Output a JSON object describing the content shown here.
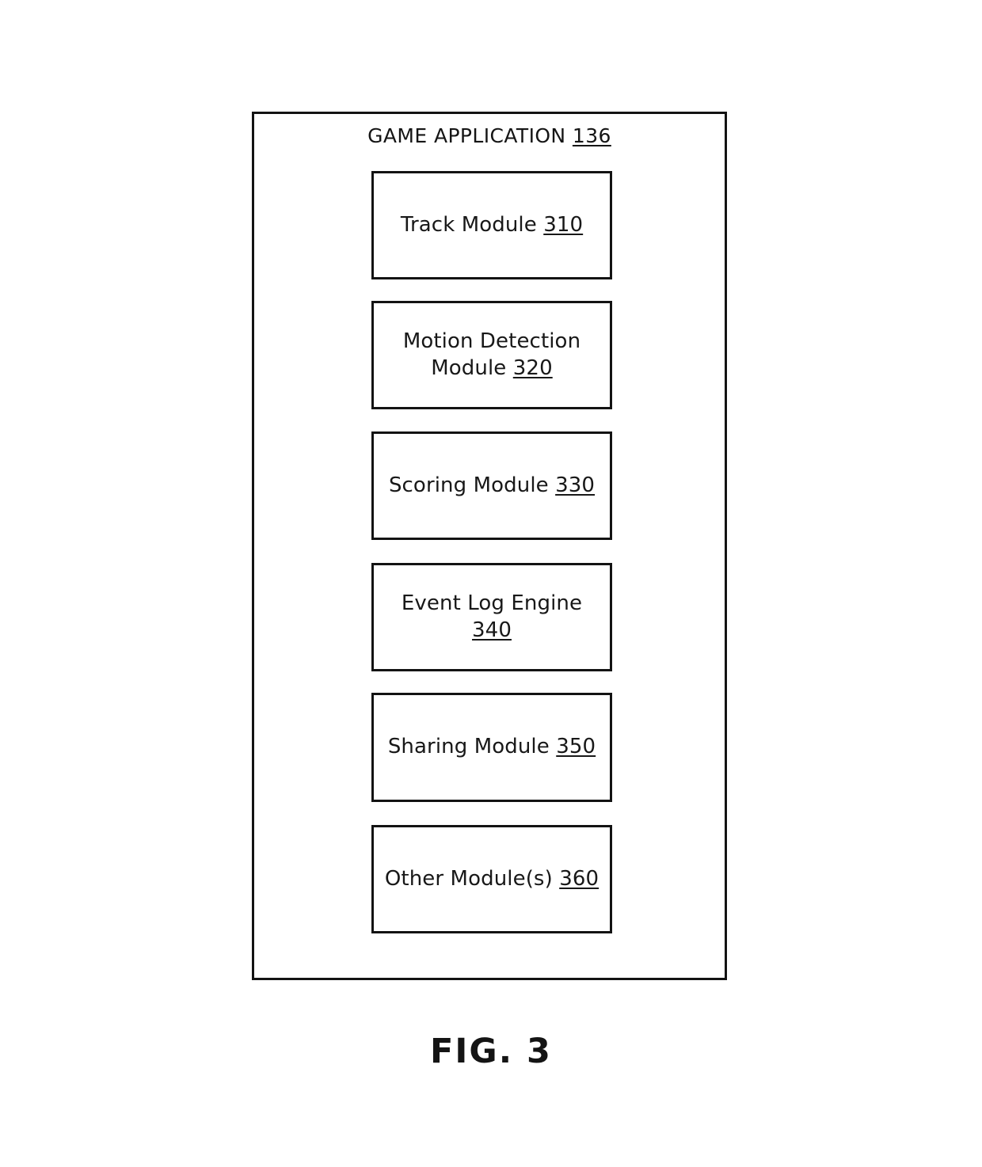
{
  "figure": {
    "caption": "FIG. 3",
    "container": {
      "title_text": "GAME APPLICATION",
      "title_ref": "136"
    },
    "modules": [
      {
        "name": "Track Module",
        "ref": "310",
        "lines": [
          "Track Module"
        ]
      },
      {
        "name": "Motion Detection Module",
        "ref": "320",
        "lines": [
          "Motion Detection",
          "Module"
        ]
      },
      {
        "name": "Scoring Module",
        "ref": "330",
        "lines": [
          "Scoring Module"
        ]
      },
      {
        "name": "Event Log Engine",
        "ref": "340",
        "lines": [
          "Event Log Engine"
        ]
      },
      {
        "name": "Sharing Module",
        "ref": "350",
        "lines": [
          "Sharing Module"
        ]
      },
      {
        "name": "Other Module(s)",
        "ref": "360",
        "lines": [
          "Other Module(s)"
        ]
      }
    ]
  },
  "style": {
    "background": "#ffffff",
    "ink": "#131313"
  }
}
